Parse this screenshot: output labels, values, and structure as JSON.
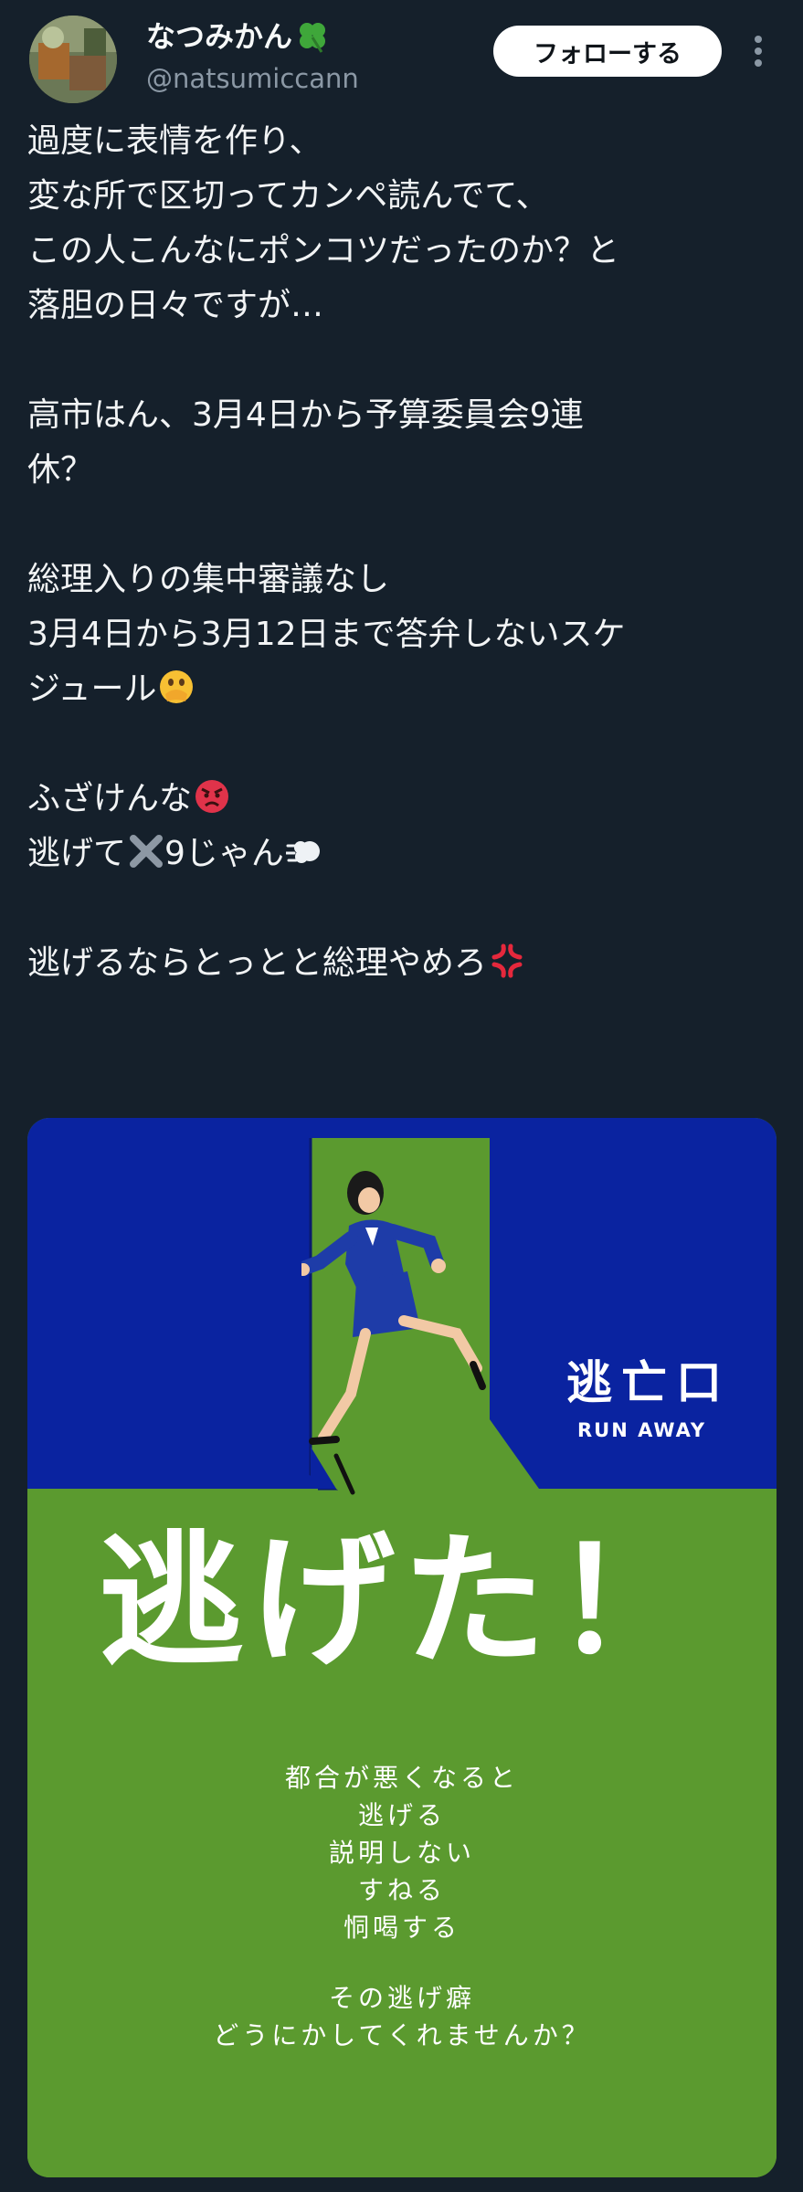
{
  "author": {
    "display_name": "なつみかん",
    "handle": "@natsumiccann"
  },
  "header": {
    "follow_label": "フォローする"
  },
  "tweet": {
    "lines": [
      "過度に表情を作り、",
      "変な所で区切ってカンペ読んでて、",
      "この人こんなにポンコツだったのか？と",
      "落胆の日々ですが…",
      "高市はん、3月4日から予算委員会9連",
      "休？",
      "総理入りの集中審議なし",
      "3月4日から3月12日まで答弁しないスケ",
      "ジュール",
      "ふざけんな",
      "逃げて",
      "9じゃん",
      "逃げるならとっとと総理やめろ"
    ]
  },
  "media": {
    "sign_jp": "逃亡口",
    "sign_en": "RUN AWAY",
    "headline": "逃げた！",
    "poem": [
      "都合が悪くなると",
      "逃げる",
      "説明しない",
      "すねる",
      "恫喝する",
      "その逃げ癖",
      "どうにかしてくれませんか？"
    ]
  },
  "colors": {
    "background": "#15202b",
    "text": "#f2f4f5",
    "handle": "#8b98a5",
    "media_blue": "#0a23a0",
    "media_green": "#5b9a2f"
  },
  "icons": {
    "clover": "four-leaf-clover-icon",
    "more": "more-vertical-icon",
    "emoji_1": "face-with-hand-over-mouth-emoji",
    "emoji_2": "angry-face-emoji",
    "emoji_3": "cross-mark-emoji",
    "emoji_4": "dash-emoji",
    "emoji_5": "anger-symbol-emoji"
  }
}
